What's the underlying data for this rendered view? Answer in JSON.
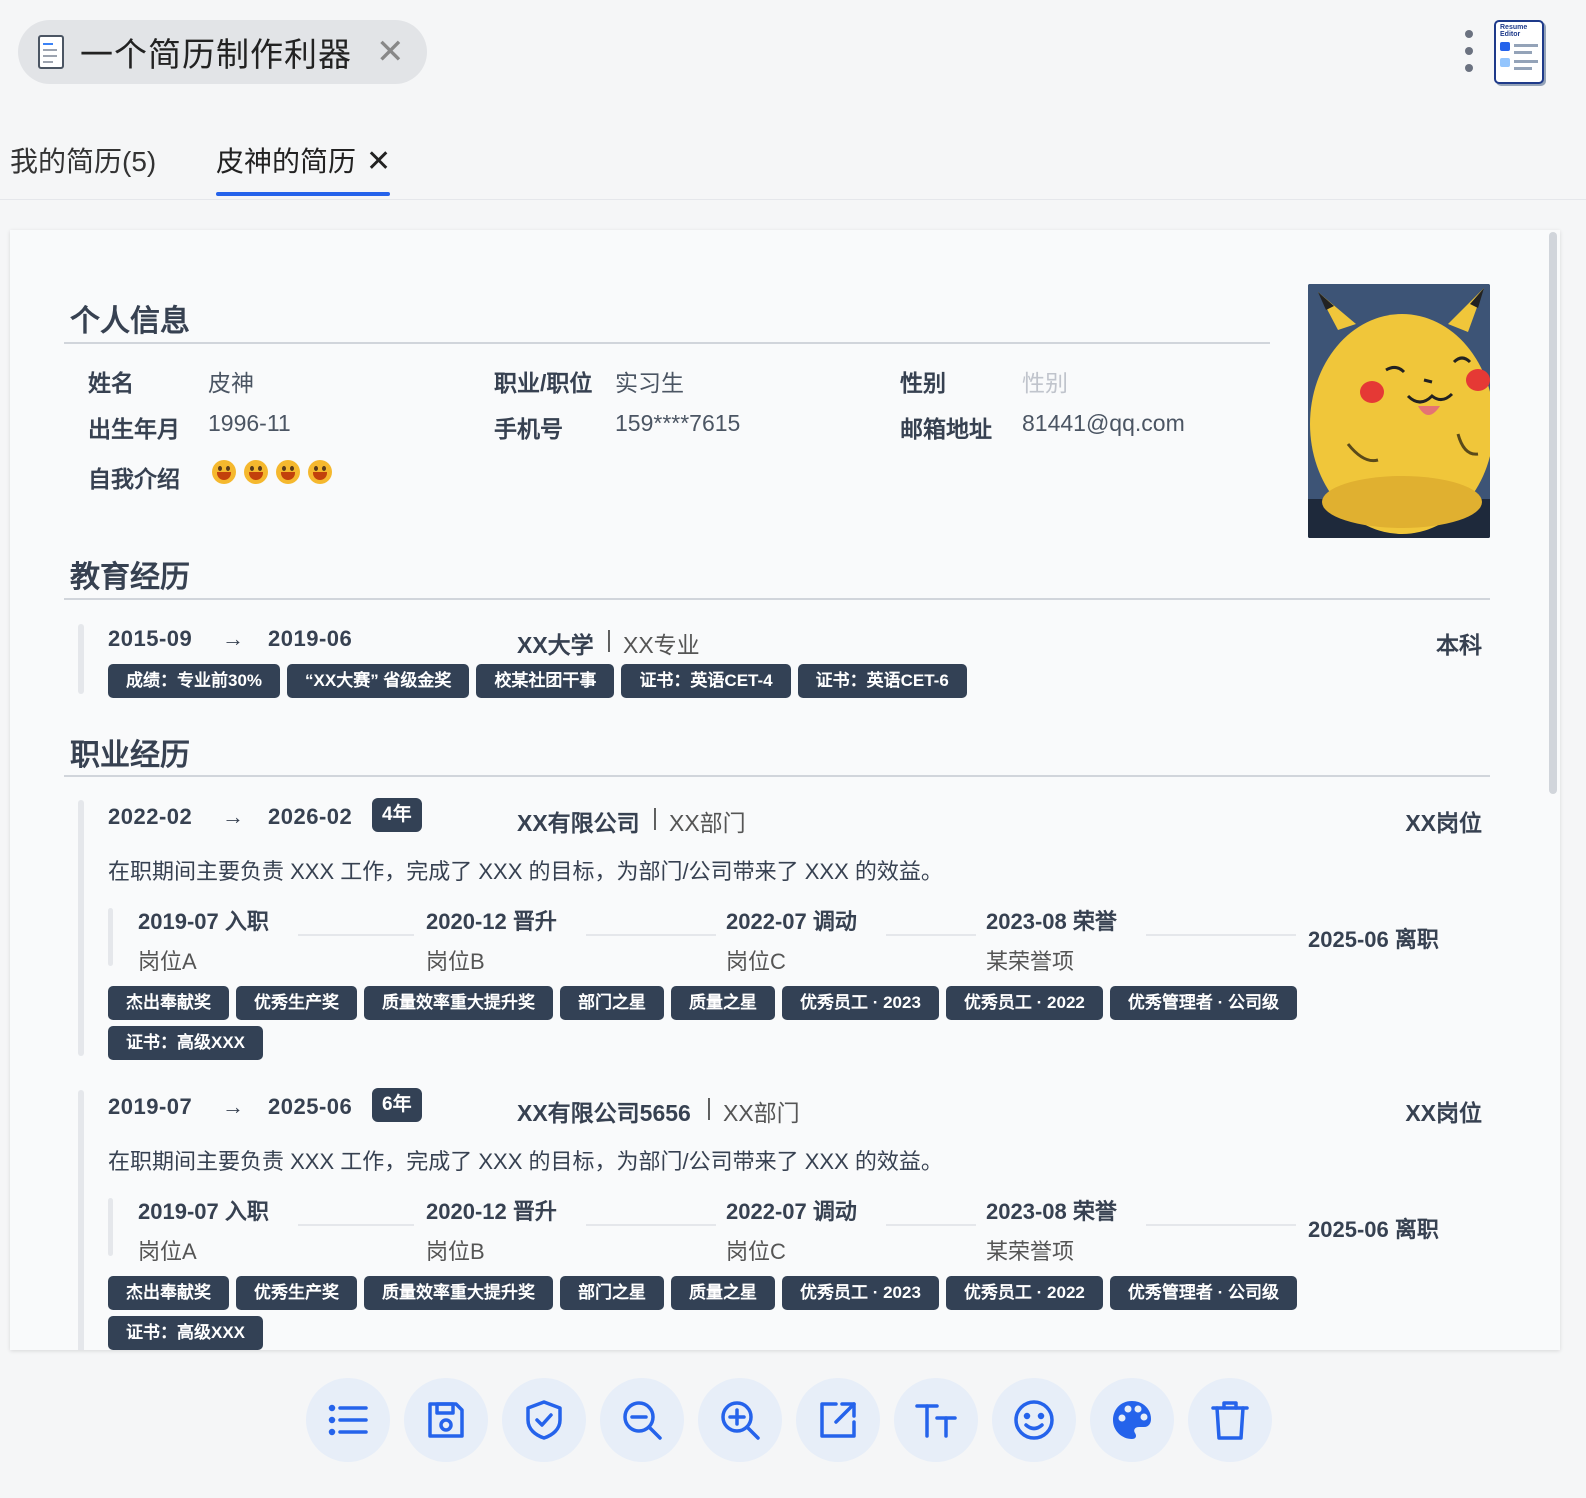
{
  "app": {
    "title": "一个简历制作利器",
    "close": "✕"
  },
  "tabs": [
    {
      "label": "我的简历(5)"
    },
    {
      "label": "皮神的简历",
      "close": "✕"
    }
  ],
  "sections": {
    "personal": "个人信息",
    "education": "教育经历",
    "career": "职业经历"
  },
  "personal": {
    "name_label": "姓名",
    "name": "皮神",
    "position_label": "职业/职位",
    "position": "实习生",
    "gender_label": "性别",
    "gender_placeholder": "性别",
    "birth_label": "出生年月",
    "birth": "1996-11",
    "phone_label": "手机号",
    "phone": "159****7615",
    "email_label": "邮箱地址",
    "email": "81441@qq.com",
    "intro_label": "自我介绍",
    "intro_emoji_count": 4
  },
  "education": {
    "start": "2015-09",
    "arrow": "→",
    "end": "2019-06",
    "school": "XX大学",
    "sep": "|",
    "major": "XX专业",
    "degree": "本科",
    "tags": [
      "成绩：专业前30%",
      "“XX大赛” 省级金奖",
      "校某社团干事",
      "证书：英语CET-4",
      "证书：英语CET-6"
    ]
  },
  "jobs": [
    {
      "start": "2022-02",
      "arrow": "→",
      "end": "2026-02",
      "duration": "4年",
      "company": "XX有限公司",
      "sep": "|",
      "dept": "XX部门",
      "role": "XX岗位",
      "desc": "在职期间主要负责 XXX 工作，完成了 XXX 的目标，为部门/公司带来了 XXX 的效益。",
      "timeline": [
        {
          "head": "2019-07  入职",
          "sub": "岗位A"
        },
        {
          "head": "2020-12  晋升",
          "sub": "岗位B"
        },
        {
          "head": "2022-07  调动",
          "sub": "岗位C"
        },
        {
          "head": "2023-08  荣誉",
          "sub": "某荣誉项"
        }
      ],
      "timeline_end": "2025-06  离职",
      "tags": [
        "杰出奉献奖",
        "优秀生产奖",
        "质量效率重大提升奖",
        "部门之星",
        "质量之星",
        "优秀员工 · 2023",
        "优秀员工 · 2022",
        "优秀管理者 · 公司级",
        "证书：高级XXX"
      ]
    },
    {
      "start": "2019-07",
      "arrow": "→",
      "end": "2025-06",
      "duration": "6年",
      "company": "XX有限公司5656",
      "sep": "|",
      "dept": "XX部门",
      "role": "XX岗位",
      "desc": "在职期间主要负责 XXX 工作，完成了 XXX 的目标，为部门/公司带来了 XXX 的效益。",
      "timeline": [
        {
          "head": "2019-07  入职",
          "sub": "岗位A"
        },
        {
          "head": "2020-12  晋升",
          "sub": "岗位B"
        },
        {
          "head": "2022-07  调动",
          "sub": "岗位C"
        },
        {
          "head": "2023-08  荣誉",
          "sub": "某荣誉项"
        }
      ],
      "timeline_end": "2025-06  离职",
      "tags": [
        "杰出奉献奖",
        "优秀生产奖",
        "质量效率重大提升奖",
        "部门之星",
        "质量之星",
        "优秀员工 · 2023",
        "优秀员工 · 2022",
        "优秀管理者 · 公司级",
        "证书：高级XXX"
      ]
    }
  ],
  "toolbar": {
    "icons": [
      "list-icon",
      "save-icon",
      "shield-check-icon",
      "zoom-out-icon",
      "zoom-in-icon",
      "export-icon",
      "font-size-icon",
      "emoji-icon",
      "palette-icon",
      "trash-icon"
    ]
  },
  "colors": {
    "accent": "#2563eb",
    "tag_bg": "#334155",
    "toolbar_btn_bg": "#e7eef8"
  }
}
